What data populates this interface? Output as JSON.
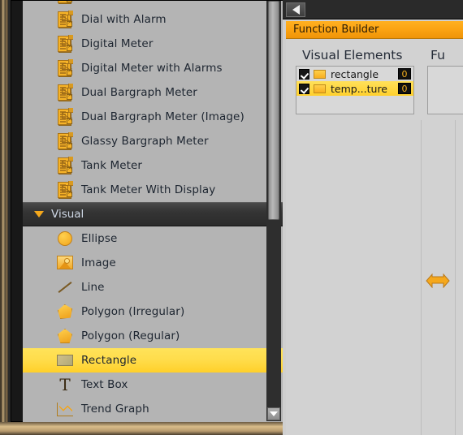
{
  "left_panel": {
    "top_list": {
      "items": [
        {
          "label": "Dial with Alarm",
          "icon": "document-icon"
        },
        {
          "label": "Digital Meter",
          "icon": "document-icon"
        },
        {
          "label": "Digital Meter with Alarms",
          "icon": "document-icon"
        },
        {
          "label": "Dual Bargraph Meter",
          "icon": "document-icon"
        },
        {
          "label": "Dual Bargraph Meter (Image)",
          "icon": "document-icon"
        },
        {
          "label": "Glassy Bargraph Meter",
          "icon": "document-icon"
        },
        {
          "label": "Tank Meter",
          "icon": "document-icon"
        },
        {
          "label": "Tank Meter With Display",
          "icon": "document-icon"
        }
      ]
    },
    "category": {
      "label": "Visual",
      "expanded": true,
      "collapse_icon": "triangle-down-icon"
    },
    "visual_items": [
      {
        "label": "Ellipse",
        "icon": "ellipse-icon",
        "selected": false
      },
      {
        "label": "Image",
        "icon": "image-icon",
        "selected": false
      },
      {
        "label": "Line",
        "icon": "line-icon",
        "selected": false
      },
      {
        "label": "Polygon (Irregular)",
        "icon": "polygon-irregular-icon",
        "selected": false
      },
      {
        "label": "Polygon (Regular)",
        "icon": "polygon-regular-icon",
        "selected": false
      },
      {
        "label": "Rectangle",
        "icon": "rectangle-icon",
        "selected": true
      },
      {
        "label": "Text Box",
        "icon": "text-box-icon",
        "selected": false
      },
      {
        "label": "Trend Graph",
        "icon": "trend-graph-icon",
        "selected": false
      }
    ],
    "scrollbar": {
      "down_arrow_icon": "triangle-down-icon"
    },
    "colors": {
      "selection": "#FFD12E",
      "list_background": "#B4B4B4",
      "category_text": "#CFD8E6"
    }
  },
  "right_panel": {
    "collapse_button_icon": "triangle-left-icon",
    "title": "Function Builder",
    "columns": {
      "visual_elements_header": "Visual Elements",
      "functions_header": "Fu"
    },
    "visual_elements": [
      {
        "checked": true,
        "name": "rectangle",
        "count": "0",
        "selected": false,
        "swatch": "#F8AE20"
      },
      {
        "checked": true,
        "name": "temp...ture",
        "count": "0",
        "selected": true,
        "swatch": "#F8AE20"
      }
    ],
    "resize_handle_icon": "double-arrow-horizontal-icon",
    "colors": {
      "title_bar": "#FBA312",
      "selection": "#FFD02C",
      "panel_background": "#D2D2D2"
    }
  }
}
